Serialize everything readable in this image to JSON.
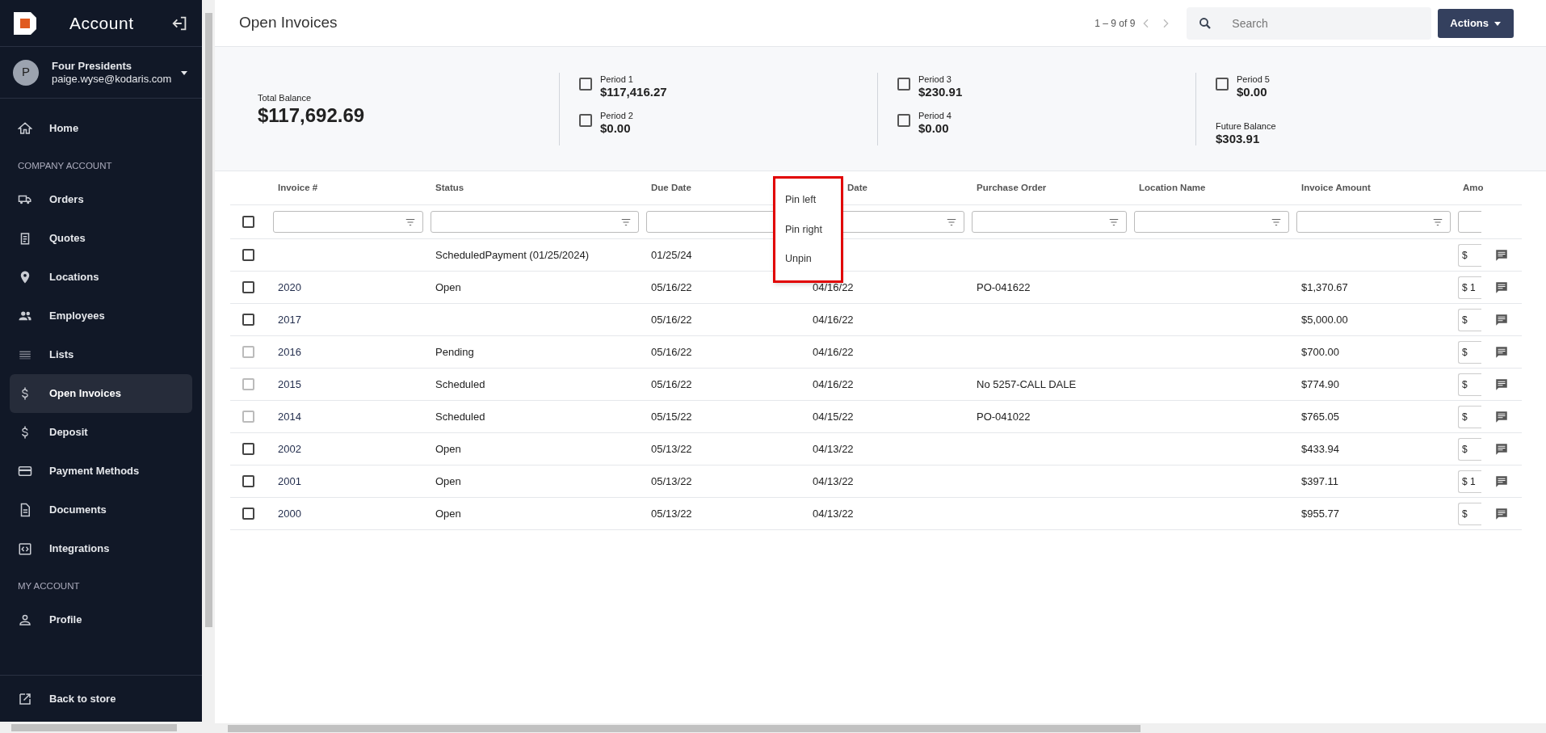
{
  "sidebar": {
    "title": "Account",
    "user": {
      "avatar": "P",
      "company": "Four Presidents",
      "email": "paige.wyse@kodaris.com"
    },
    "sections": [
      {
        "items": [
          {
            "label": "Home",
            "selected": false
          }
        ]
      },
      {
        "heading": "COMPANY ACCOUNT",
        "items": [
          {
            "label": "Orders",
            "selected": false
          },
          {
            "label": "Quotes",
            "selected": false
          },
          {
            "label": "Locations",
            "selected": false
          },
          {
            "label": "Employees",
            "selected": false
          },
          {
            "label": "Lists",
            "selected": false
          },
          {
            "label": "Open Invoices",
            "selected": true
          },
          {
            "label": "Deposit",
            "selected": false
          },
          {
            "label": "Payment Methods",
            "selected": false
          },
          {
            "label": "Documents",
            "selected": false
          },
          {
            "label": "Integrations",
            "selected": false
          }
        ]
      },
      {
        "heading": "MY ACCOUNT",
        "items": [
          {
            "label": "Profile",
            "selected": false
          }
        ]
      }
    ],
    "footer": "Back to store"
  },
  "header": {
    "title": "Open Invoices",
    "pagination": "1 – 9 of 9",
    "search": {
      "placeholder": "Search"
    },
    "actions": "Actions"
  },
  "summary": {
    "total_label": "Total Balance",
    "total": "$117,692.69",
    "periods": [
      {
        "label": "Period 1",
        "value": "$117,416.27",
        "checked": false
      },
      {
        "label": "Period 2",
        "value": "$0.00",
        "checked": false
      },
      {
        "label": "Period 3",
        "value": "$230.91",
        "checked": false
      },
      {
        "label": "Period 4",
        "value": "$0.00",
        "checked": false
      },
      {
        "label": "Period 5",
        "value": "$0.00",
        "checked": false
      }
    ],
    "future_label": "Future Balance",
    "future": "$303.91"
  },
  "table": {
    "select_all_checked": false,
    "columns": [
      "Invoice #",
      "Status",
      "Due Date",
      "Date",
      "Purchase Order",
      "Location Name",
      "Invoice Amount",
      "Amo"
    ],
    "rows": [
      {
        "checked": false,
        "disabled": false,
        "cells": [
          "",
          "ScheduledPayment (01/25/2024)",
          "01/25/24",
          "",
          "",
          "",
          ""
        ],
        "amount": "$"
      },
      {
        "checked": false,
        "disabled": false,
        "cells": [
          "2020",
          "Open",
          "05/16/22",
          "04/16/22",
          "PO-041622",
          "",
          "$1,370.67"
        ],
        "amount": "$ 1"
      },
      {
        "checked": false,
        "disabled": false,
        "cells": [
          "2017",
          "",
          "05/16/22",
          "04/16/22",
          "",
          "",
          "$5,000.00"
        ],
        "amount": "$"
      },
      {
        "checked": false,
        "disabled": true,
        "cells": [
          "2016",
          "Pending",
          "05/16/22",
          "04/16/22",
          "",
          "",
          "$700.00"
        ],
        "amount": "$"
      },
      {
        "checked": false,
        "disabled": true,
        "cells": [
          "2015",
          "Scheduled",
          "05/16/22",
          "04/16/22",
          "No 5257-CALL DALE",
          "",
          "$774.90"
        ],
        "amount": "$"
      },
      {
        "checked": false,
        "disabled": true,
        "cells": [
          "2014",
          "Scheduled",
          "05/15/22",
          "04/15/22",
          "PO-041022",
          "",
          "$765.05"
        ],
        "amount": "$"
      },
      {
        "checked": false,
        "disabled": false,
        "cells": [
          "2002",
          "Open",
          "05/13/22",
          "04/13/22",
          "",
          "",
          "$433.94"
        ],
        "amount": "$"
      },
      {
        "checked": false,
        "disabled": false,
        "cells": [
          "2001",
          "Open",
          "05/13/22",
          "04/13/22",
          "",
          "",
          "$397.11"
        ],
        "amount": "$ 1"
      },
      {
        "checked": false,
        "disabled": false,
        "cells": [
          "2000",
          "Open",
          "05/13/22",
          "04/13/22",
          "",
          "",
          "$955.77"
        ],
        "amount": "$"
      }
    ]
  },
  "column_menu": [
    "Pin left",
    "Pin right",
    "Unpin"
  ]
}
